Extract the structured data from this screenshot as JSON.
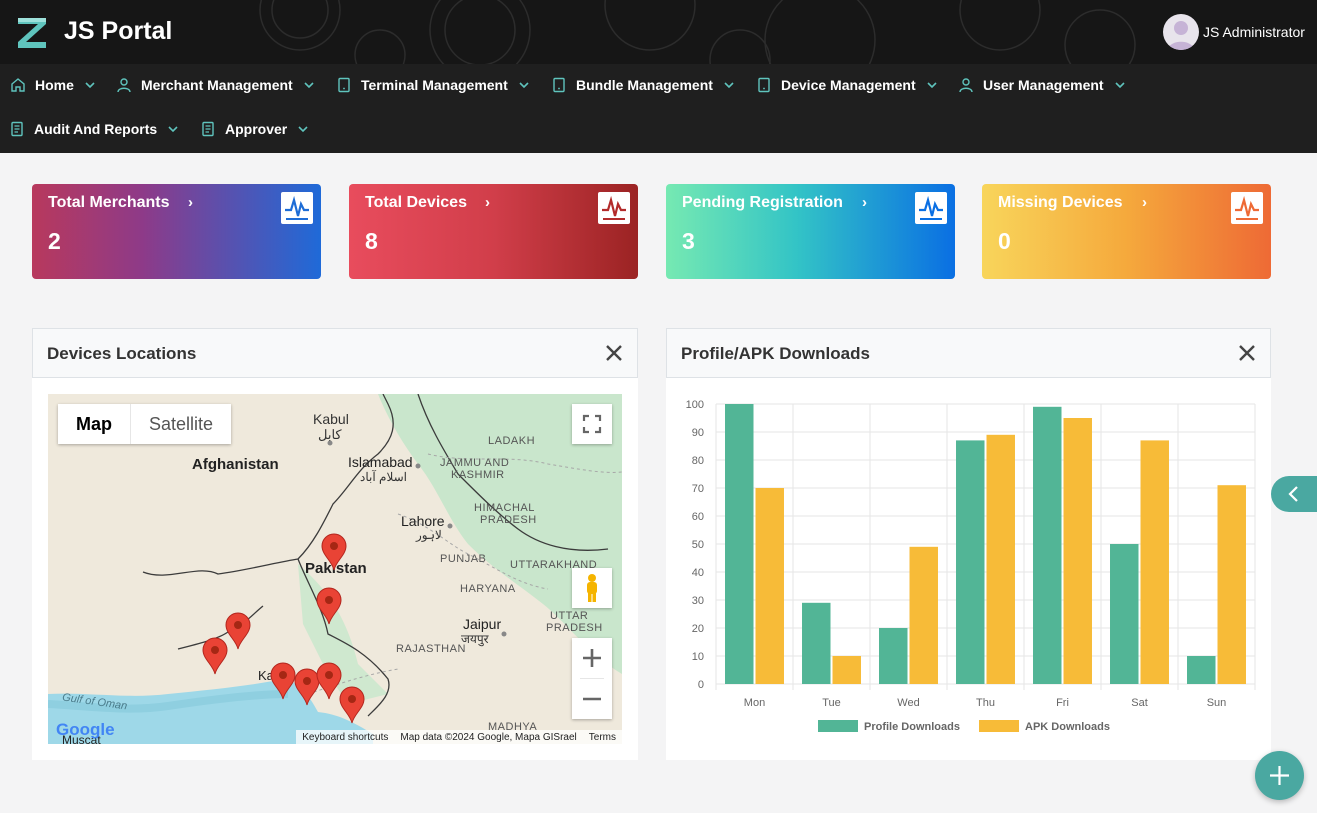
{
  "header": {
    "app_title": "JS Portal",
    "user_name": "JS Administrator"
  },
  "nav": {
    "items": [
      {
        "label": "Home",
        "icon": "home-icon"
      },
      {
        "label": "Merchant Management",
        "icon": "person-icon"
      },
      {
        "label": "Terminal Management",
        "icon": "tablet-icon"
      },
      {
        "label": "Bundle Management",
        "icon": "tablet-icon"
      },
      {
        "label": "Device Management",
        "icon": "tablet-icon"
      },
      {
        "label": "User Management",
        "icon": "person-icon"
      },
      {
        "label": "Audit And Reports",
        "icon": "document-icon"
      },
      {
        "label": "Approver",
        "icon": "document-icon"
      }
    ]
  },
  "stats": [
    {
      "title": "Total Merchants",
      "value": "2",
      "arrow": "›"
    },
    {
      "title": "Total Devices",
      "value": "8",
      "arrow": "›"
    },
    {
      "title": "Pending Registration",
      "value": "3",
      "arrow": "›"
    },
    {
      "title": "Missing Devices",
      "value": "0",
      "arrow": "›"
    }
  ],
  "colors": {
    "accent": "#4aa8a1",
    "profile_series": "#52b596",
    "apk_series": "#f7bb38"
  },
  "map_panel": {
    "title": "Devices Locations",
    "map_type_map": "Map",
    "map_type_satellite": "Satellite",
    "footer": {
      "shortcuts": "Keyboard shortcuts",
      "data": "Map data ©2024 Google, Mapa GISrael",
      "terms": "Terms"
    },
    "labels": {
      "afghanistan": "Afghanistan",
      "kabul": "Kabul",
      "kabul_local": "کابل",
      "islamabad": "Islamabad",
      "islamabad_local": "اسلام آباد",
      "jammu": "JAMMU AND",
      "kashmir": "KASHMIR",
      "ladakh": "LADAKH",
      "lahore": "Lahore",
      "lahore_local": "لاہور",
      "himachal": "HIMACHAL",
      "pradesh": "PRADESH",
      "pakistan": "Pakistan",
      "punjab": "PUNJAB",
      "uttarakhand": "UTTARAKHAND",
      "haryana": "HARYANA",
      "jaipur": "Jaipur",
      "jaipur_local": "जयपुर",
      "uttar": "UTTAR",
      "uttar_pradesh": "PRADESH",
      "rajasthan": "RAJASTHAN",
      "karachi_partial": "Ka",
      "gulf": "Gulf of Oman",
      "muscat": "Muscat",
      "madhya": "MADHYA",
      "google": "Google"
    },
    "marker_count": 8
  },
  "chart_panel": {
    "title": "Profile/APK Downloads"
  },
  "chart_data": {
    "type": "bar",
    "categories": [
      "Mon",
      "Tue",
      "Wed",
      "Thu",
      "Fri",
      "Sat",
      "Sun"
    ],
    "series": [
      {
        "name": "Profile Downloads",
        "values": [
          100,
          29,
          20,
          87,
          99,
          50,
          10
        ]
      },
      {
        "name": "APK Downloads",
        "values": [
          70,
          10,
          49,
          89,
          95,
          87,
          71
        ]
      }
    ],
    "yticks": [
      0,
      10,
      20,
      30,
      40,
      50,
      60,
      70,
      80,
      90,
      100
    ],
    "ylim": [
      0,
      100
    ],
    "grid": true,
    "legend": "bottom"
  }
}
